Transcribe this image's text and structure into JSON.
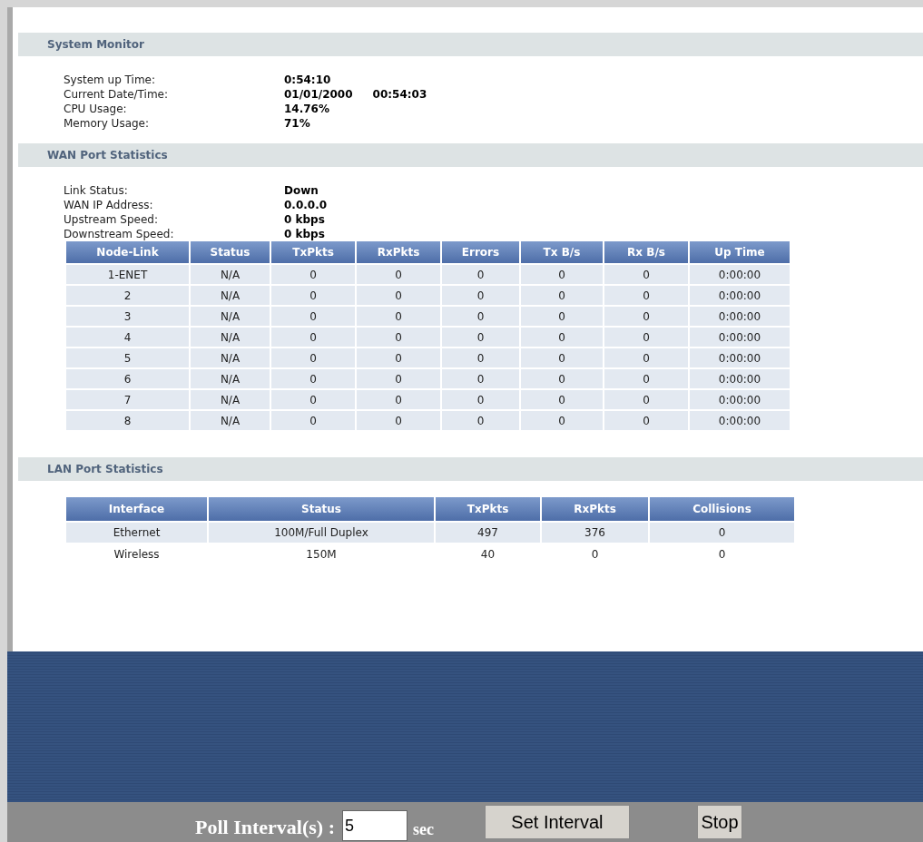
{
  "system_monitor": {
    "title": "System Monitor",
    "rows": [
      {
        "label": "System up Time:",
        "values": [
          "0:54:10"
        ]
      },
      {
        "label": "Current Date/Time:",
        "values": [
          "01/01/2000",
          "00:54:03"
        ]
      },
      {
        "label": "CPU Usage:",
        "values": [
          "14.76%"
        ]
      },
      {
        "label": "Memory Usage:",
        "values": [
          "71%"
        ]
      }
    ]
  },
  "wan": {
    "title": "WAN Port Statistics",
    "rows": [
      {
        "label": "Link Status:",
        "values": [
          "Down"
        ]
      },
      {
        "label": "WAN IP Address:",
        "values": [
          "0.0.0.0"
        ]
      },
      {
        "label": "Upstream Speed:",
        "values": [
          "0 kbps"
        ]
      },
      {
        "label": "Downstream Speed:",
        "values": [
          "0 kbps"
        ]
      }
    ],
    "table": {
      "columns": [
        "Node-Link",
        "Status",
        "TxPkts",
        "RxPkts",
        "Errors",
        "Tx B/s",
        "Rx B/s",
        "Up Time"
      ],
      "rows": [
        [
          "1-ENET",
          "N/A",
          "0",
          "0",
          "0",
          "0",
          "0",
          "0:00:00"
        ],
        [
          "2",
          "N/A",
          "0",
          "0",
          "0",
          "0",
          "0",
          "0:00:00"
        ],
        [
          "3",
          "N/A",
          "0",
          "0",
          "0",
          "0",
          "0",
          "0:00:00"
        ],
        [
          "4",
          "N/A",
          "0",
          "0",
          "0",
          "0",
          "0",
          "0:00:00"
        ],
        [
          "5",
          "N/A",
          "0",
          "0",
          "0",
          "0",
          "0",
          "0:00:00"
        ],
        [
          "6",
          "N/A",
          "0",
          "0",
          "0",
          "0",
          "0",
          "0:00:00"
        ],
        [
          "7",
          "N/A",
          "0",
          "0",
          "0",
          "0",
          "0",
          "0:00:00"
        ],
        [
          "8",
          "N/A",
          "0",
          "0",
          "0",
          "0",
          "0",
          "0:00:00"
        ]
      ]
    }
  },
  "lan": {
    "title": "LAN Port Statistics",
    "table": {
      "columns": [
        "Interface",
        "Status",
        "TxPkts",
        "RxPkts",
        "Collisions"
      ],
      "rows": [
        [
          "Ethernet",
          "100M/Full Duplex",
          "497",
          "376",
          "0"
        ],
        [
          "Wireless",
          "150M",
          "40",
          "0",
          "0"
        ]
      ]
    }
  },
  "poll": {
    "label": "Poll Interval(s) :",
    "value": "5",
    "unit": "sec",
    "buttons": [
      "Set Interval",
      "Stop"
    ]
  }
}
